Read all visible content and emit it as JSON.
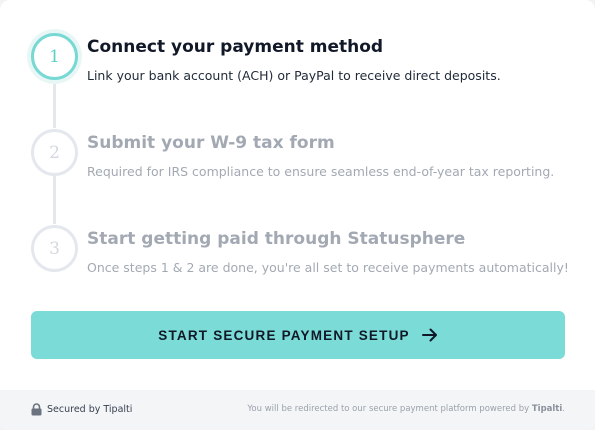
{
  "steps": [
    {
      "number": "1",
      "title": "Connect your payment method",
      "description": "Link your bank account (ACH) or PayPal to receive direct deposits.",
      "state": "active"
    },
    {
      "number": "2",
      "title": "Submit your W-9 tax form",
      "description": "Required for IRS compliance to ensure seamless end-of-year tax reporting.",
      "state": "inactive"
    },
    {
      "number": "3",
      "title": "Start getting paid through Statusphere",
      "description": "Once steps 1 & 2 are done, you're all set to receive payments automatically!",
      "state": "inactive"
    }
  ],
  "cta": {
    "label": "START SECURE PAYMENT SETUP",
    "icon": "arrow-right-icon"
  },
  "footer": {
    "secured_label": "Secured by Tipalti",
    "secured_icon": "lock-icon",
    "redirect_text": "You will be redirected to our secure payment platform powered by",
    "redirect_brand": "Tipalti",
    "redirect_suffix": "."
  },
  "colors": {
    "accent": "#7adbd7",
    "accent_ring": "#78d8d4",
    "active_text": "#111827",
    "inactive_text": "#a3a9b3"
  }
}
